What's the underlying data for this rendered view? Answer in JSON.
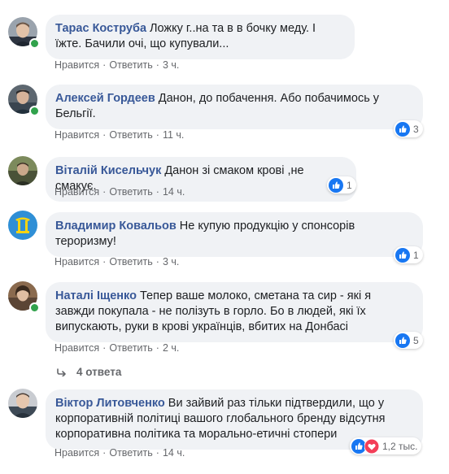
{
  "actions": {
    "like": "Нравится",
    "reply": "Ответить",
    "sep": "·"
  },
  "comments": [
    {
      "author": "Тарас Коструба",
      "text": "Ложку г..на та в в бочку меду. І їжте. Бачили очі, що купували...",
      "time": "3 ч.",
      "reactions": null,
      "online": true
    },
    {
      "author": "Алексей Гордеев",
      "text": "Данон, до побачення. Або побачимось у Бельгії.",
      "time": "11 ч.",
      "reactions": "3",
      "online": true
    },
    {
      "author": "Віталій Кисельчук",
      "text": "Данон зі смаком крові ,не смакує.",
      "time": "14 ч.",
      "reactions": "1",
      "online": false
    },
    {
      "author": "Владимир Ковальов",
      "text": "Не купую продукцію у спонсорів тероризму!",
      "time": "3 ч.",
      "reactions": "1",
      "online": false
    },
    {
      "author": "Наталі Іщенко",
      "text": "Тепер ваше молоко, сметана та сир - які я завжди покупала - не полізуть в горло. Бо в людей, які їх випускають, руки в крові українців, вбитих на Донбасі",
      "time": "2 ч.",
      "reactions": "5",
      "online": true
    },
    {
      "author": "Віктор Литовченко",
      "text": "Ви зайвий раз тільки підтвердили, що у корпоративній політиці вашого глобального бренду відсутня корпоративна політика та морально-етичні стопери",
      "time": "14 ч.",
      "reactions": "1,2 тыс.",
      "online": false
    }
  ],
  "replies_label": "4 ответа",
  "colors": {
    "author": "#385898",
    "bubble": "#f0f2f5",
    "like_blue": "#1877f2",
    "love_red": "#f33e58",
    "online": "#31a24c"
  }
}
